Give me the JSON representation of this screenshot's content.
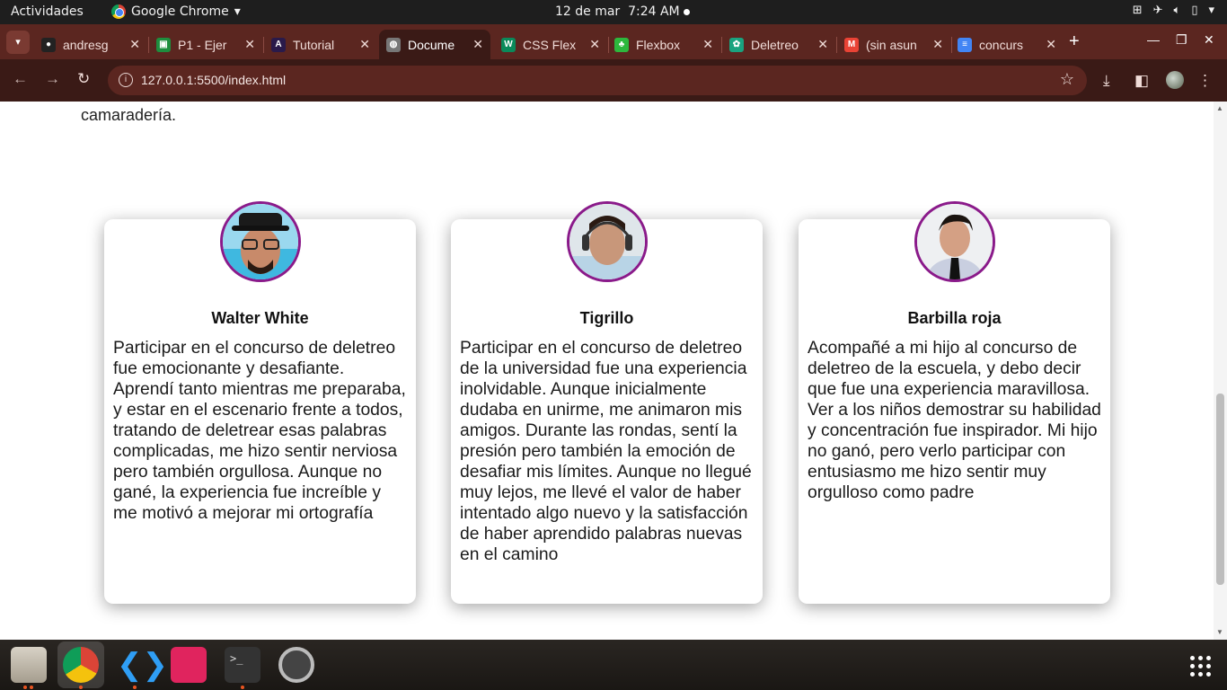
{
  "topbar": {
    "activities": "Actividades",
    "app_name": "Google Chrome",
    "date": "12 de mar",
    "time": "7:24 AM"
  },
  "tabs": [
    {
      "title": "andresg",
      "favicon": "github-icon",
      "color": "#222222",
      "glyph": "●"
    },
    {
      "title": "P1 - Ejer",
      "favicon": "classroom-icon",
      "color": "#1e8e3e",
      "glyph": "▣"
    },
    {
      "title": "Tutorial",
      "favicon": "astro-icon",
      "color": "#2a1a4a",
      "glyph": "A"
    },
    {
      "title": "Docume",
      "favicon": "globe-icon",
      "color": "#777777",
      "glyph": "◍"
    },
    {
      "title": "CSS Flex",
      "favicon": "w-icon",
      "color": "#0a8a5a",
      "glyph": "W"
    },
    {
      "title": "Flexbox",
      "favicon": "froggy-icon",
      "color": "#2db83d",
      "glyph": "♣"
    },
    {
      "title": "Deletreo",
      "favicon": "chatgpt-icon",
      "color": "#19a37f",
      "glyph": "✿"
    },
    {
      "title": "(sin asun",
      "favicon": "gmail-icon",
      "color": "#ea4335",
      "glyph": "M"
    },
    {
      "title": "concurs",
      "favicon": "docs-icon",
      "color": "#4285f4",
      "glyph": "≡"
    }
  ],
  "address": {
    "url": "127.0.0.1:5500/index.html"
  },
  "page": {
    "intro_tail": "camaradería.",
    "cards": [
      {
        "name": "Walter White",
        "text": "Participar en el concurso de deletreo fue emocionante y desafiante. Aprendí tanto mientras me preparaba, y estar en el escenario frente a todos, tratando de deletrear esas palabras complicadas, me hizo sentir nerviosa pero también orgullosa. Aunque no gané, la experiencia fue increíble y me motivó a mejorar mi ortografía"
      },
      {
        "name": "Tigrillo",
        "text": "Participar en el concurso de deletreo de la universidad fue una experiencia inolvidable. Aunque inicialmente dudaba en unirme, me animaron mis amigos. Durante las rondas, sentí la presión pero también la emoción de desafiar mis límites. Aunque no llegué muy lejos, me llevé el valor de haber intentado algo nuevo y la satisfacción de haber aprendido palabras nuevas en el camino"
      },
      {
        "name": "Barbilla roja",
        "text": "Acompañé a mi hijo al concurso de deletreo de la escuela, y debo decir que fue una experiencia maravillosa. Ver a los niños demostrar su habilidad y concentración fue inspirador. Mi hijo no ganó, pero verlo participar con entusiasmo me hizo sentir muy orgulloso como padre"
      }
    ]
  },
  "dock": [
    "files-icon",
    "chrome-icon",
    "vscode-icon",
    "screenshot-icon",
    "terminal-icon",
    "settings-icon"
  ],
  "colors": {
    "tabstrip": "#5b2620",
    "toolbar": "#3a1a16",
    "avatar_border": "#8a1a8a"
  }
}
